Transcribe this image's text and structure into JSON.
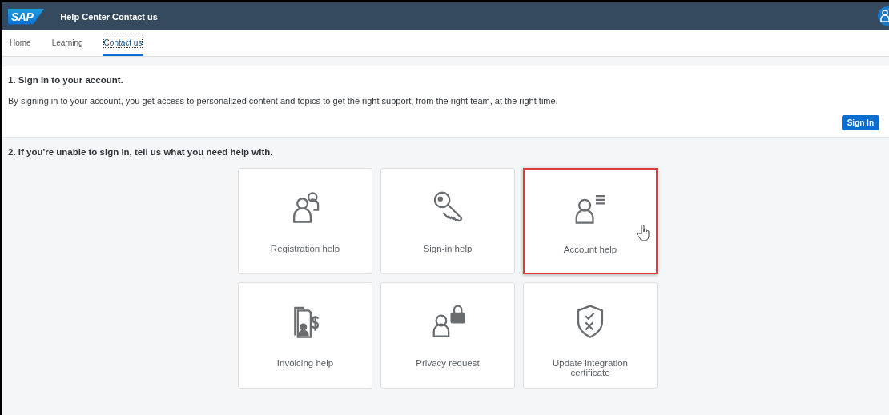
{
  "header": {
    "logo": "SAP",
    "title": "Help Center Contact us"
  },
  "tabs": [
    {
      "label": "Home",
      "selected": false
    },
    {
      "label": "Learning",
      "selected": false
    },
    {
      "label": "Contact us",
      "selected": true
    }
  ],
  "section_1": {
    "heading": "1. Sign in to your account.",
    "text": "By signing in to your account, you get access to personalized content and topics to get the right support, from the right team, at the right time.",
    "button": "Sign In"
  },
  "section_2": {
    "heading": "2. If you're unable to sign in, tell us what you need help with.",
    "tiles": [
      {
        "kind": "registration",
        "label": "Registration help",
        "highlighted": false
      },
      {
        "kind": "signin",
        "label": "Sign-in help",
        "highlighted": false
      },
      {
        "kind": "account",
        "label": "Account help",
        "highlighted": true
      },
      {
        "kind": "invoice",
        "label": "Invoicing help",
        "highlighted": false
      },
      {
        "kind": "privacy",
        "label": "Privacy request",
        "highlighted": false
      },
      {
        "kind": "certificate",
        "label": "Update integration certificate",
        "highlighted": false
      }
    ]
  }
}
